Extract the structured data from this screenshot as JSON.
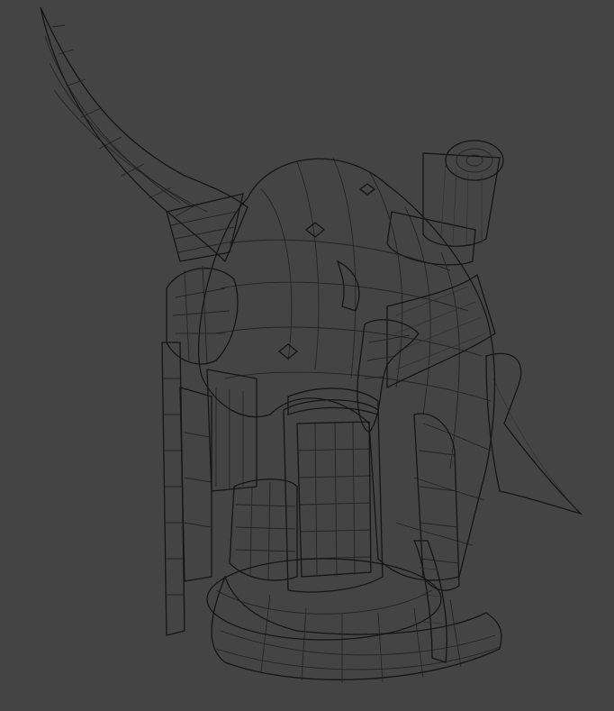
{
  "viewport": {
    "background_color": "#444444",
    "mesh_color": "#8a8a8a",
    "wire_color": "#1e1e1e"
  },
  "scene": {
    "subject": "wireframe-helmet-model",
    "parts": [
      {
        "name": "horn-icon"
      },
      {
        "name": "helmet-dome"
      },
      {
        "name": "face-guard"
      },
      {
        "name": "cheek-plate"
      },
      {
        "name": "cylinder-stub"
      },
      {
        "name": "neck-base"
      },
      {
        "name": "back-flap"
      }
    ]
  }
}
